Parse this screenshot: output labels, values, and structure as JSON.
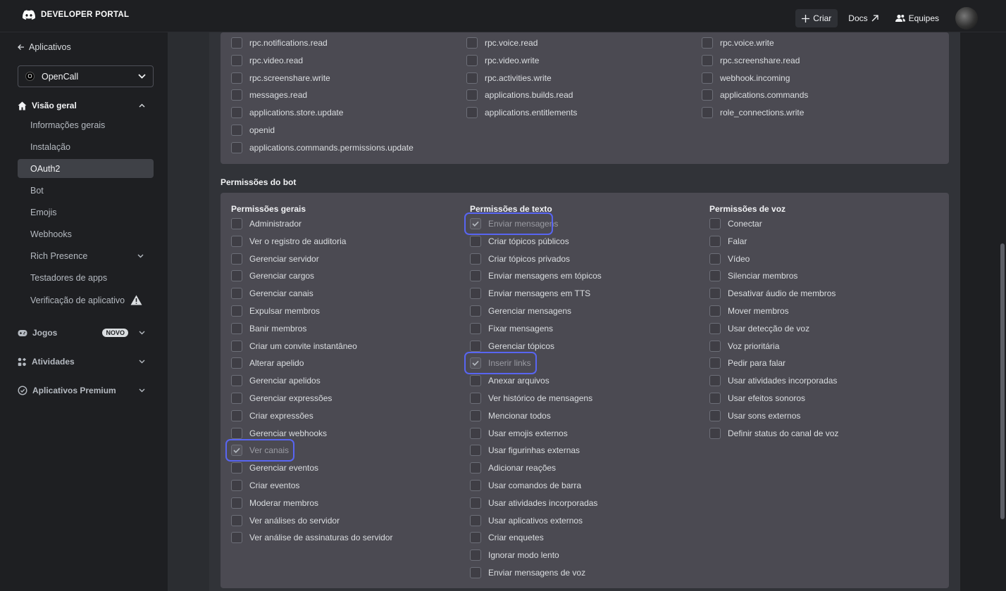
{
  "topbar": {
    "brand": "DEVELOPER PORTAL",
    "create_label": "Criar",
    "docs_label": "Docs",
    "teams_label": "Equipes"
  },
  "sidebar": {
    "back_label": "Aplicativos",
    "app_name": "OpenCall",
    "app_initial": "O",
    "overview": "Visão geral",
    "items": [
      {
        "label": "Informações gerais"
      },
      {
        "label": "Instalação"
      },
      {
        "label": "OAuth2"
      },
      {
        "label": "Bot"
      },
      {
        "label": "Emojis"
      },
      {
        "label": "Webhooks"
      },
      {
        "label": "Rich Presence"
      },
      {
        "label": "Testadores de apps"
      },
      {
        "label": "Verificação de aplicativo"
      }
    ],
    "sections": [
      {
        "label": "Jogos",
        "badge": "NOVO"
      },
      {
        "label": "Atividades"
      },
      {
        "label": "Aplicativos Premium"
      }
    ]
  },
  "scopes": {
    "col1": [
      "rpc.notifications.read",
      "rpc.video.read",
      "rpc.screenshare.write",
      "messages.read",
      "applications.store.update",
      "openid",
      "applications.commands.permissions.update"
    ],
    "col2": [
      "rpc.voice.read",
      "rpc.video.write",
      "rpc.activities.write",
      "applications.builds.read",
      "applications.entitlements"
    ],
    "col3": [
      "rpc.voice.write",
      "rpc.screenshare.read",
      "webhook.incoming",
      "applications.commands",
      "role_connections.write"
    ]
  },
  "bot_permissions": {
    "title": "Permissões do bot",
    "general": {
      "heading": "Permissões gerais",
      "items": [
        "Administrador",
        "Ver o registro de auditoria",
        "Gerenciar servidor",
        "Gerenciar cargos",
        "Gerenciar canais",
        "Expulsar membros",
        "Banir membros",
        "Criar um convite instantâneo",
        "Alterar apelido",
        "Gerenciar apelidos",
        "Gerenciar expressões",
        "Criar expressões",
        "Gerenciar webhooks",
        "Ver canais",
        "Gerenciar eventos",
        "Criar eventos",
        "Moderar membros",
        "Ver análises do servidor",
        "Ver análise de assinaturas do servidor"
      ]
    },
    "text": {
      "heading": "Permissões de texto",
      "items": [
        "Enviar mensagens",
        "Criar tópicos públicos",
        "Criar tópicos privados",
        "Enviar mensagens em tópicos",
        "Enviar mensagens em TTS",
        "Gerenciar mensagens",
        "Fixar mensagens",
        "Gerenciar tópicos",
        "Inserir links",
        "Anexar arquivos",
        "Ver histórico de mensagens",
        "Mencionar todos",
        "Usar emojis externos",
        "Usar figurinhas externas",
        "Adicionar reações",
        "Usar comandos de barra",
        "Usar atividades incorporadas",
        "Usar aplicativos externos",
        "Criar enquetes",
        "Ignorar modo lento",
        "Enviar mensagens de voz"
      ]
    },
    "voice": {
      "heading": "Permissões de voz",
      "items": [
        "Conectar",
        "Falar",
        "Vídeo",
        "Silenciar membros",
        "Desativar áudio de membros",
        "Mover membros",
        "Usar detecção de voz",
        "Voz prioritária",
        "Pedir para falar",
        "Usar atividades incorporadas",
        "Usar efeitos sonoros",
        "Usar sons externos",
        "Definir status do canal de voz"
      ]
    },
    "checked": [
      "Ver canais",
      "Enviar mensagens",
      "Inserir links"
    ]
  }
}
